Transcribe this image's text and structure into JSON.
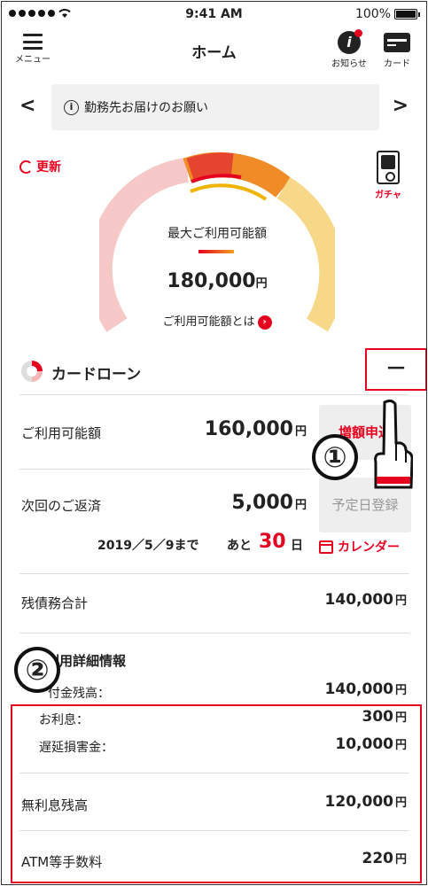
{
  "status_bar": {
    "time": "9:41 AM",
    "battery": "100%"
  },
  "header": {
    "menu_label": "メニュー",
    "title": "ホーム",
    "notice_label": "お知らせ",
    "card_label": "カード"
  },
  "banner": {
    "text": "勤務先お届けのお願い",
    "info_icon": "i"
  },
  "refresh_label": "更新",
  "gacha_label": "ガチャ",
  "gauge": {
    "label": "最大ご利用可能額",
    "amount": "180,000",
    "unit": "円",
    "link": "ご利用可能額とは"
  },
  "loan": {
    "title": "カードローン",
    "collapse_symbol": "－",
    "available_label": "ご利用可能額",
    "available_amount": "160,000",
    "increase_button": "増額申込",
    "next_payment_label": "次回のご返済",
    "next_payment_amount": "5,000",
    "schedule_button": "予定日登録",
    "due_date": "2019／5／9まで",
    "due_prefix": "あと",
    "due_days": "30",
    "due_suffix": "日",
    "calendar_label": "カレンダー",
    "total_debt_label": "残債務合計",
    "total_debt_amount": "140,000",
    "details_label": "利用詳細情報",
    "balance_label": "付金残高：",
    "balance_amount": "140,000",
    "interest_label": "お利息：",
    "interest_amount": "300",
    "late_fee_label": "遅延損害金：",
    "late_fee_amount": "10,000",
    "interest_free_label": "無利息残高",
    "interest_free_amount": "120,000",
    "atm_fee_label": "ATM等手数料",
    "atm_fee_amount": "220",
    "unit": "円"
  },
  "annotations": {
    "step1": "①",
    "step2": "②"
  },
  "colors": {
    "accent": "#e60020",
    "gauge_orange": "#f08c28",
    "gauge_yellow": "#f7c94a",
    "gauge_pink": "#f6c8c8"
  }
}
